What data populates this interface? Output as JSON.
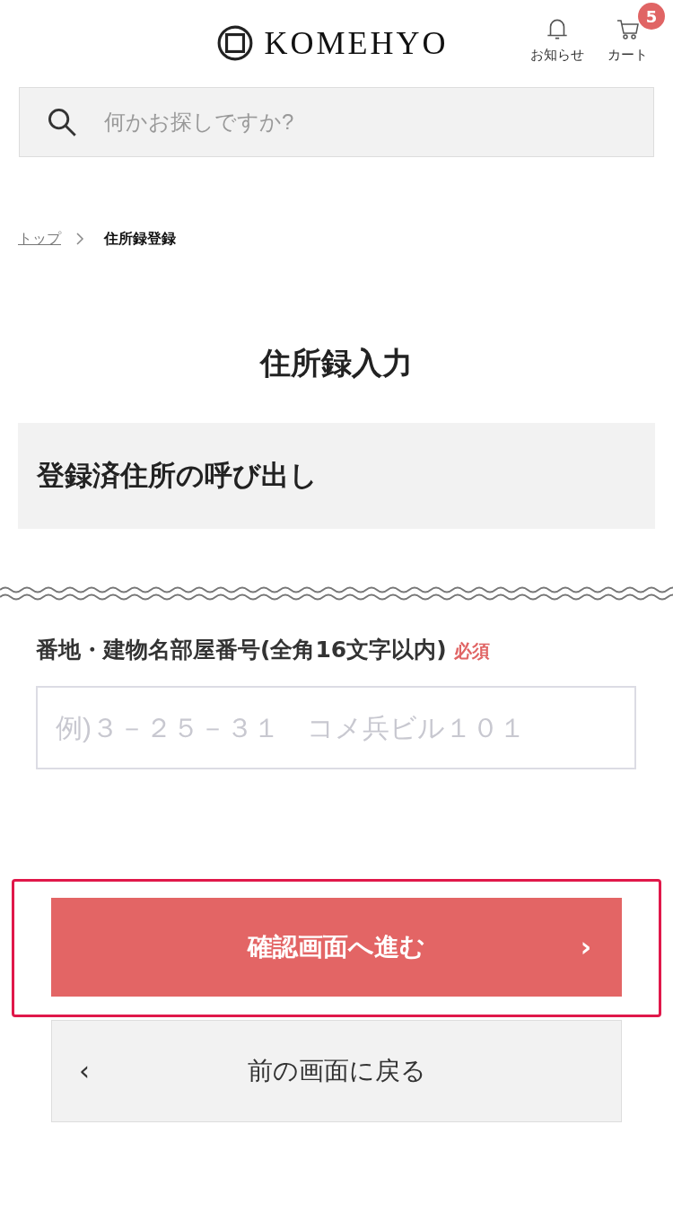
{
  "header": {
    "logo": "KOMEHYO",
    "notice": {
      "label": "お知らせ"
    },
    "cart": {
      "label": "カート",
      "count": "5"
    }
  },
  "search": {
    "placeholder": "何かお探しですか?"
  },
  "breadcrumb": [
    {
      "label": "トップ",
      "link": true
    },
    {
      "label": "住所録登録",
      "link": false
    }
  ],
  "title": "住所録入力",
  "recall": {
    "label": "登録済住所の呼び出し"
  },
  "field": {
    "label": "番地・建物名部屋番号(全角16文字以内)",
    "required": "必須",
    "placeholder": "例)３－２５－３１　コメ兵ビル１０１"
  },
  "buttons": [
    {
      "kind": "primary",
      "label": "確認画面へ進む",
      "arrow": "›",
      "highlighted": true
    },
    {
      "kind": "secondary",
      "label": "前の画面に戻る",
      "arrow": "‹",
      "highlighted": false
    }
  ]
}
